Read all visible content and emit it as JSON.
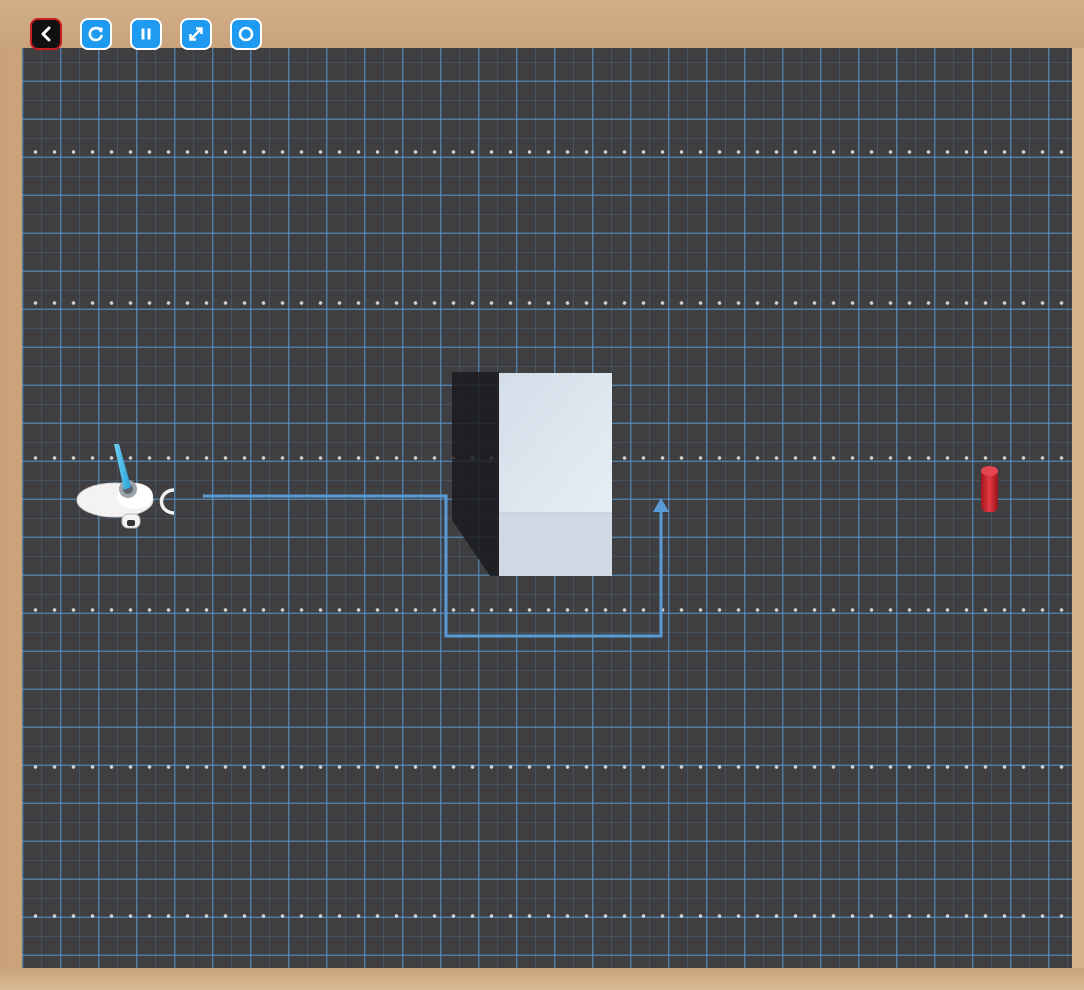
{
  "toolbar": {
    "buttons": [
      {
        "name": "back",
        "icon": "chevron-left-icon",
        "color": "#111111",
        "border": "#c81e1e"
      },
      {
        "name": "restart",
        "icon": "restart-icon",
        "color": "#1e9af0"
      },
      {
        "name": "pause",
        "icon": "pause-icon",
        "color": "#1e9af0"
      },
      {
        "name": "fullscreen",
        "icon": "expand-icon",
        "color": "#1e9af0"
      },
      {
        "name": "camera",
        "icon": "record-icon",
        "color": "#1e9af0"
      }
    ]
  },
  "scene": {
    "mat_color": "#3f3f42",
    "grid_color": "#5aa0dc",
    "obstacle_color": "#dde6ef",
    "path_color": "#5b9bd5",
    "target_color": "#d42a36",
    "robot_color": "#f2f2f2"
  }
}
